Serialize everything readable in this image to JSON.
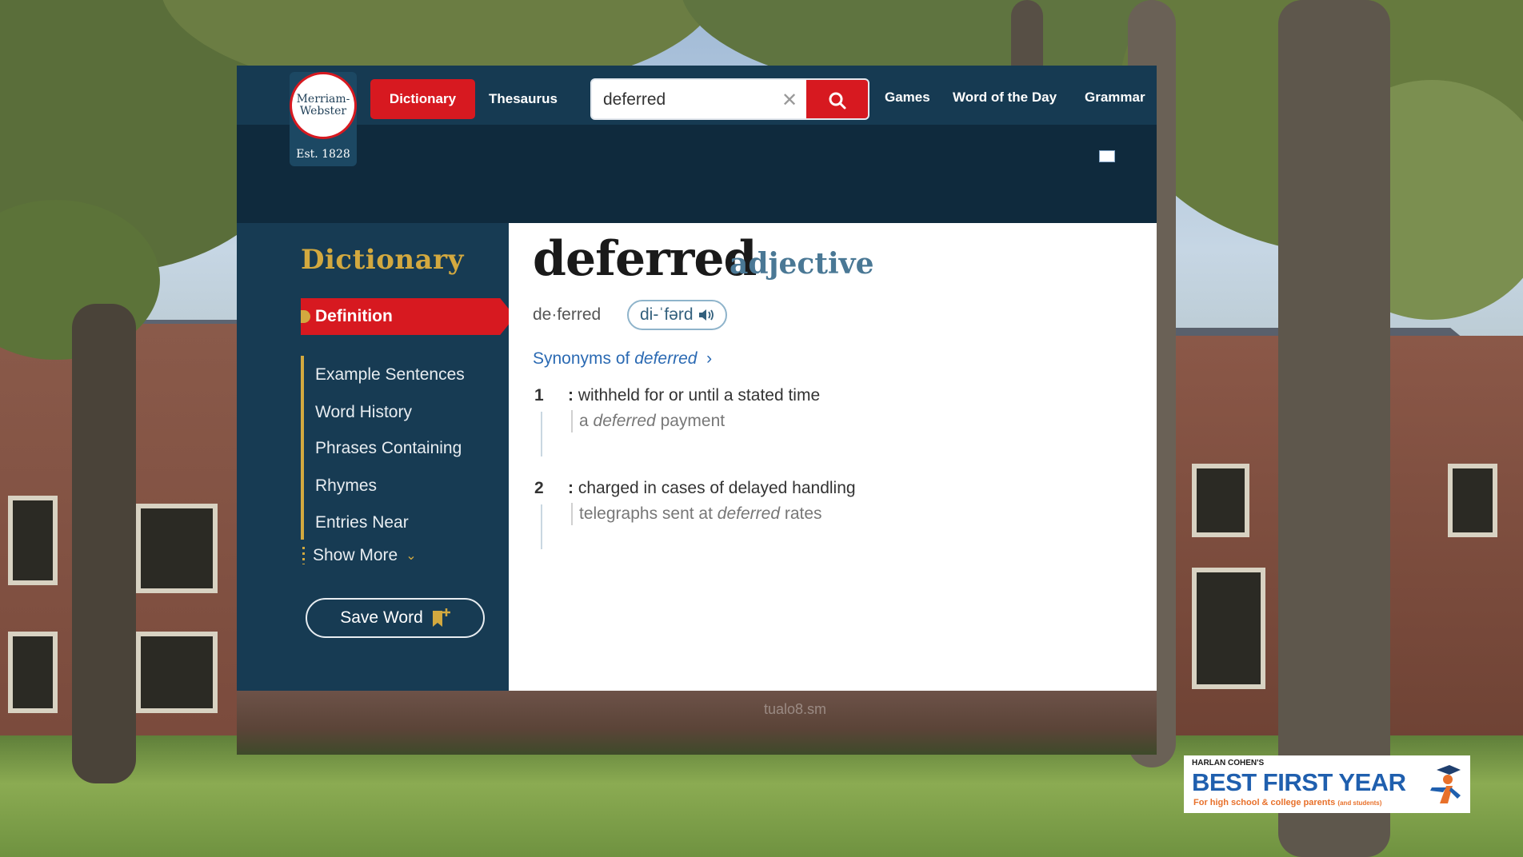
{
  "logo": {
    "line1": "Merriam-",
    "line2": "Webster",
    "est": "Est. 1828"
  },
  "nav": {
    "tab_dictionary": "Dictionary",
    "tab_thesaurus": "Thesaurus",
    "search_value": "deferred",
    "links": [
      "Games",
      "Word of the Day",
      "Grammar"
    ]
  },
  "sidebar": {
    "title": "Dictionary",
    "active": "Definition",
    "items": [
      "Example Sentences",
      "Word History",
      "Phrases Containing",
      "Rhymes",
      "Entries Near"
    ],
    "show_more": "Show More",
    "save_word": "Save Word"
  },
  "entry": {
    "headword": "deferred",
    "part_of_speech": "adjective",
    "syllables": "de·ferred",
    "pronunciation": "di-ˈfərd",
    "synonyms_prefix": "Synonyms of ",
    "synonyms_word": "deferred",
    "senses": [
      {
        "num": "1",
        "def": "withheld for or until a stated time",
        "ex_before": "a ",
        "ex_italic": "deferred",
        "ex_after": " payment"
      },
      {
        "num": "2",
        "def": "charged in cases of delayed handling",
        "ex_before": "telegraphs sent at ",
        "ex_italic": "deferred",
        "ex_after": " rates"
      }
    ]
  },
  "overlay": {
    "small": "HARLAN COHEN'S",
    "title": "BEST FIRST YEAR",
    "subtitle": "For high school & college parents",
    "subtitle_small": "(and students)",
    "watermark": "tualo8.sm"
  },
  "colors": {
    "brand_red": "#d71920",
    "navy": "#173b53",
    "gold": "#d3a93f",
    "link_blue": "#2b6ab3"
  }
}
